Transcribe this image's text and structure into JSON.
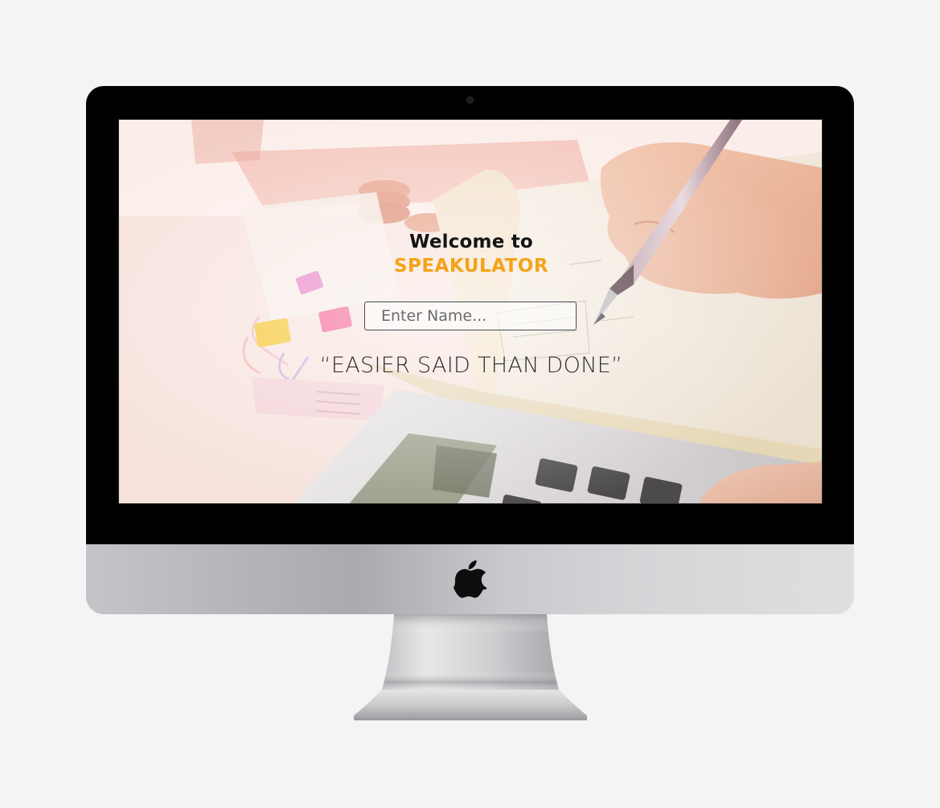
{
  "device": {
    "type": "desktop-monitor",
    "logo_icon": "apple-logo-icon"
  },
  "screen": {
    "welcome_text": "Welcome to",
    "brand_text": "SPEAKULATOR",
    "name_input": {
      "placeholder": "Enter Name...",
      "value": ""
    },
    "quote_text": "“EASIER SAID THAN DONE”",
    "background_image": "desk-with-calculator-notebook-pen-photo"
  },
  "colors": {
    "brand": "#f5a31a",
    "heading": "#141414",
    "bezel": "#000000",
    "page_background": "#f4f4f4"
  }
}
